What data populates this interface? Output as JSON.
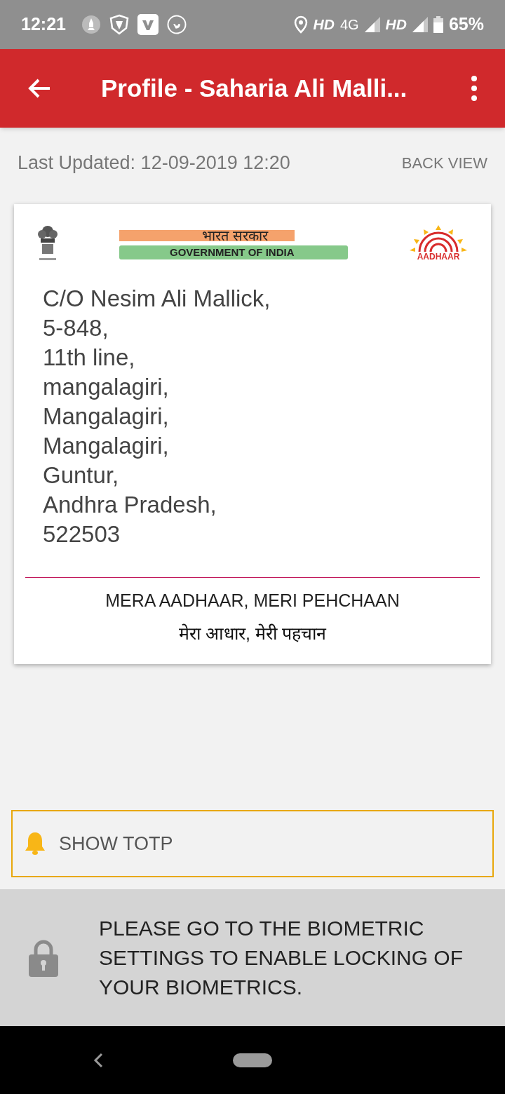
{
  "status_bar": {
    "time": "12:21",
    "network_1": "HD",
    "network_type": "4G",
    "network_2": "HD",
    "battery": "65%"
  },
  "app_bar": {
    "title": "Profile - Saharia Ali Malli..."
  },
  "info": {
    "last_updated": "Last Updated: 12-09-2019 12:20",
    "back_view": "BACK VIEW"
  },
  "card": {
    "banner_hindi": "भारत सरकार",
    "banner_english": "GOVERNMENT OF INDIA",
    "aadhaar_label": "AADHAAR",
    "address_lines": [
      "C/O Nesim Ali Mallick,",
      "5-848,",
      "11th line,",
      "mangalagiri,",
      "Mangalagiri,",
      "Mangalagiri,",
      "Guntur,",
      "Andhra Pradesh,",
      "522503"
    ],
    "motto_english": "MERA AADHAAR, MERI PEHCHAAN",
    "motto_hindi": "मेरा आधार, मेरी पहचान"
  },
  "totp_button": {
    "label": "SHOW TOTP"
  },
  "biometric_notice": {
    "text": "PLEASE GO TO THE BIOMETRIC SETTINGS TO ENABLE LOCKING OF YOUR BIOMETRICS."
  }
}
